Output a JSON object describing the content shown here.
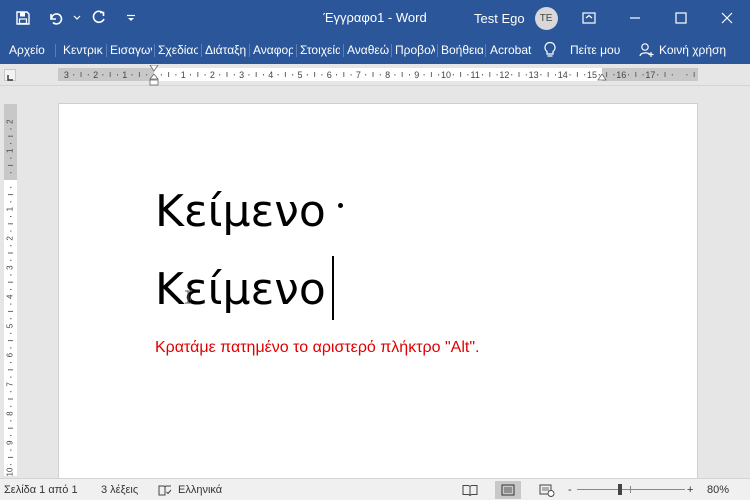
{
  "window": {
    "title": "Έγγραφο1 - Word",
    "user_name": "Test Ego",
    "user_initials": "TE"
  },
  "quick_access": {
    "icons": [
      "save-icon",
      "undo-icon",
      "undo-dropdown-icon",
      "redo-icon",
      "customize-qat-icon"
    ]
  },
  "ribbon": {
    "tabs": [
      {
        "label": "Αρχείο"
      },
      {
        "label": "Κεντρική"
      },
      {
        "label": "Εισαγωγή"
      },
      {
        "label": "Σχεδίαση"
      },
      {
        "label": "Διάταξη"
      },
      {
        "label": "Αναφορές"
      },
      {
        "label": "Στοιχεία"
      },
      {
        "label": "Αναθεώρηση"
      },
      {
        "label": "Προβολή"
      },
      {
        "label": "Βοήθεια"
      },
      {
        "label": "Acrobat"
      }
    ],
    "tell_me": "Πείτε μου",
    "share": "Κοινή χρήση"
  },
  "ruler": {
    "horizontal_labels": [
      "3",
      "2",
      "1",
      "1",
      "2",
      "3",
      "4",
      "5",
      "6",
      "7",
      "8",
      "9",
      "10",
      "11",
      "12",
      "13",
      "14",
      "15",
      "16",
      "17"
    ],
    "vertical_labels": [
      "2",
      "1",
      "1",
      "2",
      "3",
      "4",
      "5",
      "6",
      "7",
      "8",
      "9",
      "10"
    ]
  },
  "document": {
    "line1": "Κείμενο",
    "line2": "Κείμενο",
    "note": "Κρατάμε πατημένο το αριστερό πλήκτρο \"Alt\"."
  },
  "statusbar": {
    "page": "Σελίδα 1 από 1",
    "words": "3 λέξεις",
    "language": "Ελληνικά",
    "zoom_minus": "-",
    "zoom_plus": "+",
    "zoom": "80%"
  },
  "colors": {
    "titlebar": "#2b579a",
    "note_text": "#e00000"
  }
}
